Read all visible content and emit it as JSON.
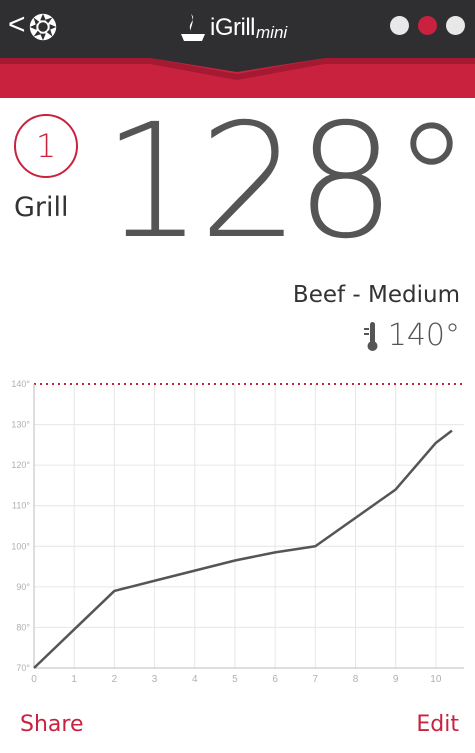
{
  "header": {
    "back_glyph": "<",
    "logo_word": "iGrill",
    "logo_sub": "mini",
    "icons": {
      "back": "chevron-left-icon",
      "settings": "gear-icon",
      "logo": "flame-icon"
    },
    "page_dots": 3,
    "active_dot": 2
  },
  "probe": {
    "number": "1",
    "name": "Grill",
    "current_temp": "128°",
    "preset": "Beef - Medium",
    "target_temp": "140°",
    "target_icon": "thermometer-icon"
  },
  "footer": {
    "share_label": "Share",
    "edit_label": "Edit"
  },
  "colors": {
    "accent": "#c8223f",
    "header_bg": "#2f2f31",
    "text": "#333333",
    "temp_text": "#555555"
  },
  "chart_data": {
    "type": "line",
    "x": [
      0,
      1,
      2,
      3,
      4,
      5,
      6,
      7,
      8,
      9,
      10,
      10.4
    ],
    "y": [
      70,
      79.5,
      89,
      91.5,
      94,
      96.5,
      98.5,
      100,
      107,
      114,
      125.5,
      128.5
    ],
    "target_line": 140,
    "xlim": [
      0,
      10.7
    ],
    "ylim": [
      70,
      140
    ],
    "x_ticks": [
      "0",
      "1",
      "2",
      "3",
      "4",
      "5",
      "6",
      "7",
      "8",
      "9",
      "10"
    ],
    "y_ticks": [
      "70°",
      "80°",
      "90°",
      "100°",
      "110°",
      "120°",
      "130°",
      "140°"
    ],
    "grid": true
  }
}
